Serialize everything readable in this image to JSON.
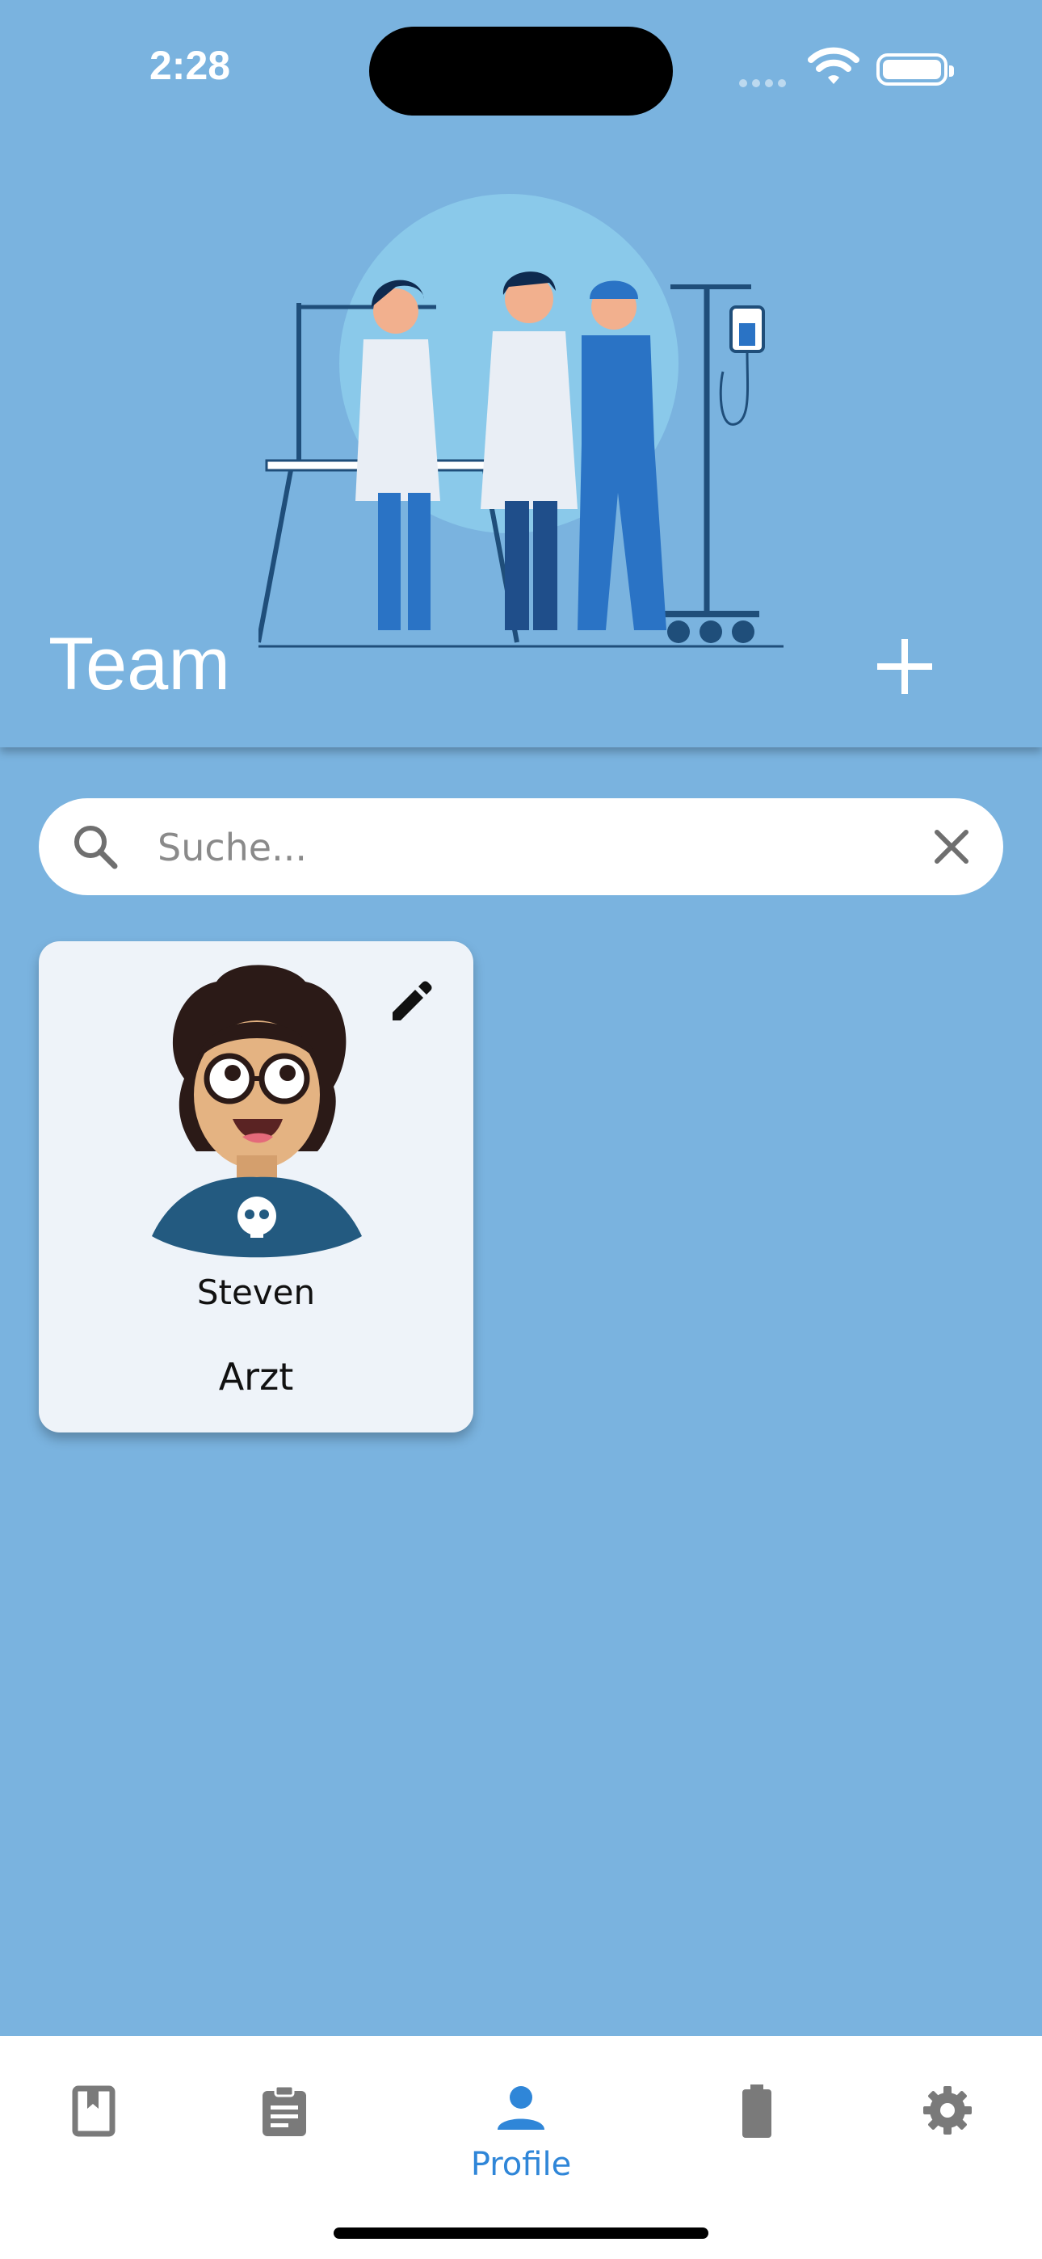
{
  "status": {
    "time": "2:28"
  },
  "header": {
    "title": "Team"
  },
  "search": {
    "placeholder": "Suche..."
  },
  "cards": [
    {
      "name": "Steven",
      "role": "Arzt"
    }
  ],
  "nav": {
    "items": [
      {
        "icon": "book-icon",
        "label": ""
      },
      {
        "icon": "clipboard-icon",
        "label": ""
      },
      {
        "icon": "person-icon",
        "label": "Profile"
      },
      {
        "icon": "battery-icon",
        "label": ""
      },
      {
        "icon": "gear-icon",
        "label": ""
      }
    ]
  },
  "colors": {
    "background": "#7AB3DF",
    "accent": "#2F86D8",
    "card": "#EEF3F9"
  }
}
